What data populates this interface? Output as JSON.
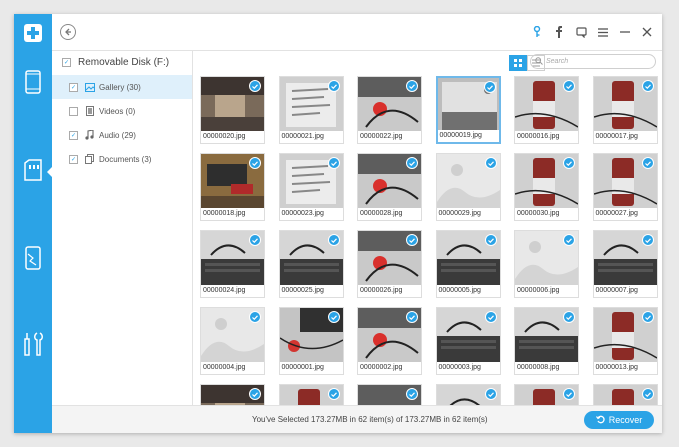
{
  "tree": {
    "root_label": "Removable Disk (F:)",
    "items": [
      {
        "label": "Gallery (30)",
        "checked": true,
        "icon": "image-icon",
        "selected": true
      },
      {
        "label": "Videos (0)",
        "checked": false,
        "icon": "film-icon",
        "selected": false
      },
      {
        "label": "Audio (29)",
        "checked": true,
        "icon": "music-icon",
        "selected": false
      },
      {
        "label": "Documents (3)",
        "checked": true,
        "icon": "documents-icon",
        "selected": false
      }
    ]
  },
  "search": {
    "placeholder": "Search"
  },
  "thumbnails": [
    {
      "name": "00000020.jpg",
      "kind": "photo-a"
    },
    {
      "name": "00000021.jpg",
      "kind": "photo-b"
    },
    {
      "name": "00000022.jpg",
      "kind": "photo-c"
    },
    {
      "name": "00000019.jpg",
      "kind": "photo-d",
      "selected": true
    },
    {
      "name": "00000016.jpg",
      "kind": "photo-e"
    },
    {
      "name": "00000017.jpg",
      "kind": "photo-e"
    },
    {
      "name": "00000018.jpg",
      "kind": "photo-f"
    },
    {
      "name": "00000023.jpg",
      "kind": "photo-b"
    },
    {
      "name": "00000028.jpg",
      "kind": "photo-c"
    },
    {
      "name": "00000029.jpg",
      "kind": "placeholder"
    },
    {
      "name": "00000030.jpg",
      "kind": "photo-e"
    },
    {
      "name": "00000027.jpg",
      "kind": "photo-e"
    },
    {
      "name": "00000024.jpg",
      "kind": "photo-g"
    },
    {
      "name": "00000025.jpg",
      "kind": "photo-g"
    },
    {
      "name": "00000026.jpg",
      "kind": "photo-c"
    },
    {
      "name": "00000005.jpg",
      "kind": "photo-g"
    },
    {
      "name": "00000006.jpg",
      "kind": "placeholder"
    },
    {
      "name": "00000007.jpg",
      "kind": "photo-g"
    },
    {
      "name": "00000004.jpg",
      "kind": "placeholder"
    },
    {
      "name": "00000001.jpg",
      "kind": "photo-h"
    },
    {
      "name": "00000002.jpg",
      "kind": "photo-c"
    },
    {
      "name": "00000003.jpg",
      "kind": "photo-g"
    },
    {
      "name": "00000008.jpg",
      "kind": "photo-g"
    },
    {
      "name": "00000013.jpg",
      "kind": "photo-e"
    },
    {
      "name": "",
      "kind": "photo-a"
    },
    {
      "name": "",
      "kind": "photo-e"
    },
    {
      "name": "",
      "kind": "photo-c"
    },
    {
      "name": "",
      "kind": "photo-g"
    },
    {
      "name": "",
      "kind": "photo-e"
    },
    {
      "name": "",
      "kind": "photo-e"
    }
  ],
  "status": {
    "text": "You've Selected 173.27MB in 62 item(s) of 173.27MB in 62 item(s)"
  },
  "recover": {
    "label": "Recover"
  },
  "colors": {
    "accent": "#2ba3e6"
  }
}
